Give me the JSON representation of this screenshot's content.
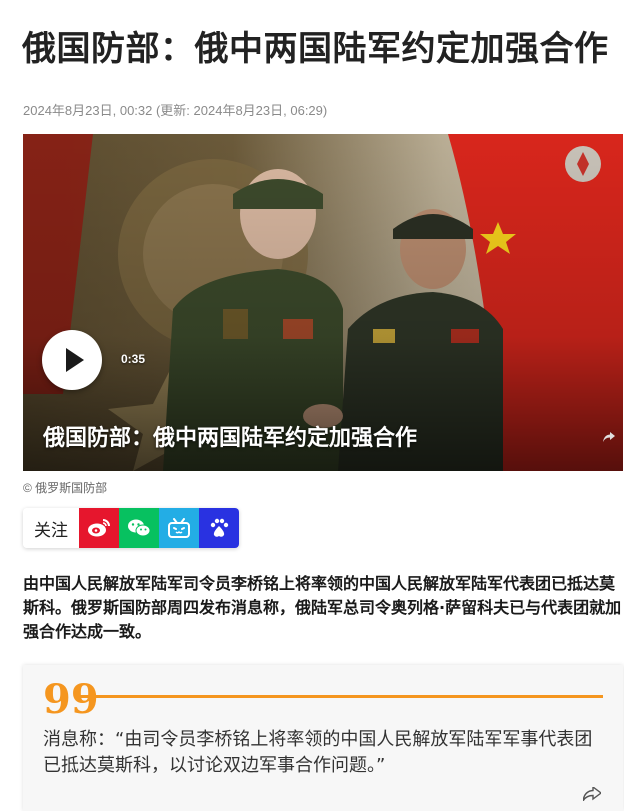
{
  "article": {
    "title": "俄国防部：俄中两国陆军约定加强合作",
    "meta": "2024年8月23日, 00:32 (更新: 2024年8月23日, 06:29)"
  },
  "media": {
    "duration": "0:35",
    "title": "俄国防部：俄中两国陆军约定加强合作",
    "credit": "© 俄罗斯国防部"
  },
  "social": {
    "follow_label": "关注",
    "buttons": [
      {
        "icon": "weibo-icon",
        "color": "#e6162d"
      },
      {
        "icon": "wechat-icon",
        "color": "#07c160"
      },
      {
        "icon": "bilibili-icon",
        "color": "#23ade5"
      },
      {
        "icon": "baidu-icon",
        "color": "#2932e1"
      }
    ]
  },
  "lead": "由中国人民解放军陆军司令员李桥铭上将率领的中国人民解放军陆军代表团已抵达莫斯科。俄罗斯国防部周四发布消息称，俄陆军总司令奥列格·萨留科夫已与代表团就加强合作达成一致。",
  "quote": {
    "mark": "99",
    "text": "消息称：“由司令员李桥铭上将率领的中国人民解放军陆军军事代表团已抵达莫斯科，以讨论双边军事合作问题。”"
  },
  "colors": {
    "accent": "#f5961f",
    "flag_red": "#d8261c"
  }
}
